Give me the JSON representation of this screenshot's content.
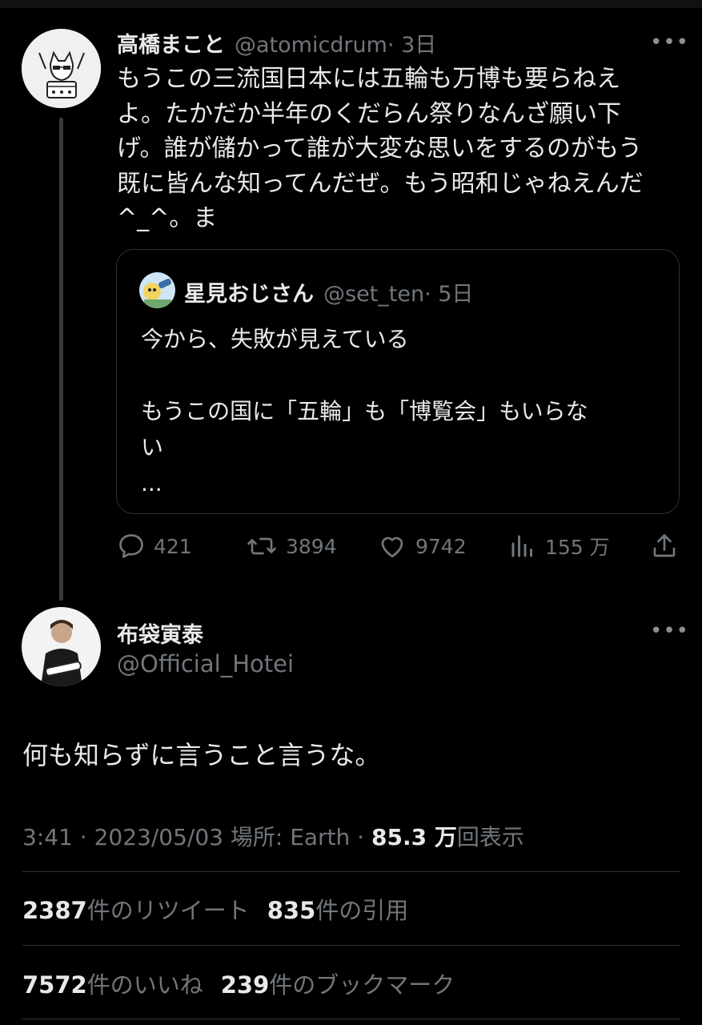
{
  "tweet1": {
    "name": "高橋まこと",
    "handle": "@atomicdrum",
    "time": "· 3日",
    "more": "•••",
    "text": "もうこの三流国日本には五輪も万博も要らねえ\nよ。たかだか半年のくだらん祭りなんざ願い下\nげ。誰が儲かって誰が大変な思いをするのがもう\n既に皆んな知ってんだぜ。もう昭和じゃねえんだ\n^_^。ま",
    "quote": {
      "name": "星見おじさん",
      "handle": "@set_ten",
      "time": "· 5日",
      "text": "今から、失敗が見えている\n\nもうこの国に「五輪」も「博覧会」もいらな\nい\n..."
    },
    "actions": {
      "replies": "421",
      "retweets": "3894",
      "likes": "9742",
      "views": "155 万"
    }
  },
  "tweet2": {
    "name": "布袋寅泰",
    "handle": "@Official_Hotei",
    "more": "•••",
    "text": "何も知らずに言うこと言うな。",
    "meta": {
      "time_date": "3:41 · 2023/05/03 場所: Earth · ",
      "views_num": "85.3 万",
      "views_label": "回表示"
    },
    "stats": {
      "retweets_num": "2387",
      "retweets_label": "件のリツイート",
      "quotes_num": "835",
      "quotes_label": "件の引用",
      "likes_num": "7572",
      "likes_label": "件のいいね",
      "bookmarks_num": "239",
      "bookmarks_label": "件のブックマーク"
    }
  },
  "colors": {
    "background": "#000000",
    "text": "#e7e9ea",
    "muted": "#71767b",
    "border": "#2f3336"
  }
}
